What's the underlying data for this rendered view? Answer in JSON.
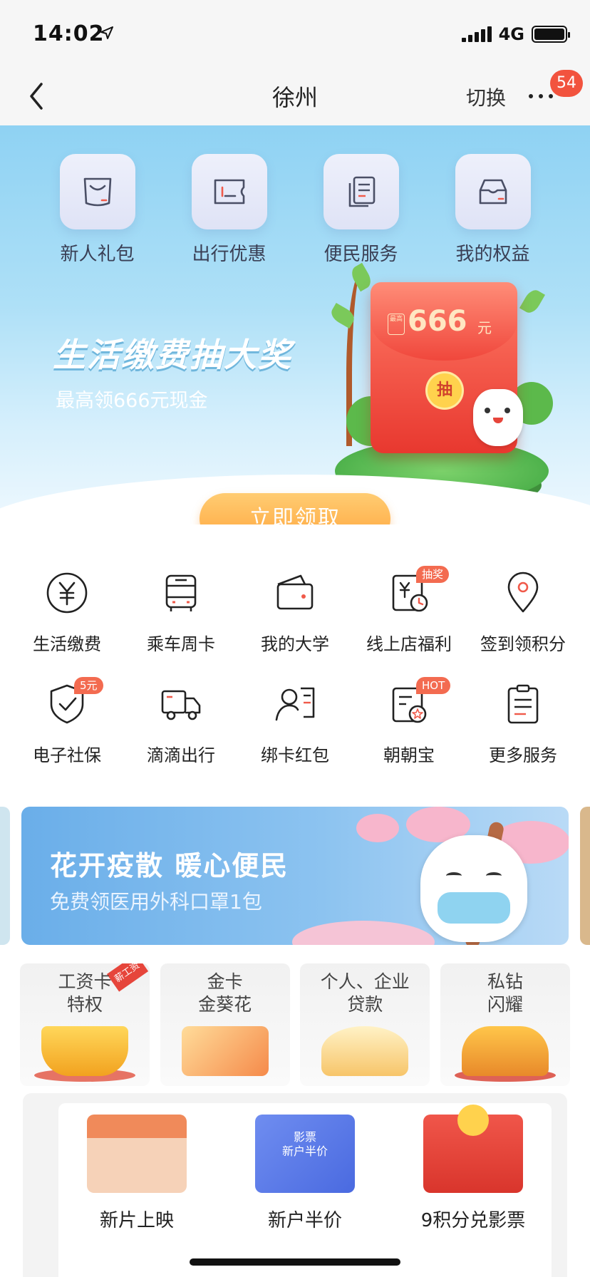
{
  "status_bar": {
    "time": "14:02",
    "network": "4G",
    "battery_level": 1.0
  },
  "nav": {
    "title": "徐州",
    "switch_label": "切换",
    "message_count": "54"
  },
  "quick_links": [
    {
      "label": "新人礼包",
      "icon": "shopping-bag-icon"
    },
    {
      "label": "出行优惠",
      "icon": "ticket-icon"
    },
    {
      "label": "便民服务",
      "icon": "documents-icon"
    },
    {
      "label": "我的权益",
      "icon": "inbox-tray-icon"
    }
  ],
  "hero": {
    "title": "生活缴费抽大奖",
    "subtitle": "最高领666元现金",
    "envelope_tag": "最高",
    "envelope_amount": "666",
    "envelope_unit": "元",
    "envelope_seal": "抽",
    "cta_label": "立即领取",
    "colors": {
      "sky": "#8fd2f3",
      "cta": "#ffa63e",
      "envelope": "#e8382f"
    }
  },
  "services": [
    [
      {
        "label": "生活缴费",
        "icon": "yen-circle-icon"
      },
      {
        "label": "乘车周卡",
        "icon": "bus-icon"
      },
      {
        "label": "我的大学",
        "icon": "wallet-icon"
      },
      {
        "label": "线上店福利",
        "icon": "yen-clock-icon",
        "badge": "抽奖"
      },
      {
        "label": "签到领积分",
        "icon": "location-pin-icon"
      }
    ],
    [
      {
        "label": "电子社保",
        "icon": "shield-check-icon",
        "badge": "5元"
      },
      {
        "label": "滴滴出行",
        "icon": "truck-icon"
      },
      {
        "label": "绑卡红包",
        "icon": "user-card-icon"
      },
      {
        "label": "朝朝宝",
        "icon": "star-document-icon",
        "badge": "HOT"
      },
      {
        "label": "更多服务",
        "icon": "clipboard-list-icon"
      }
    ]
  ],
  "banner": {
    "title": "花开疫散 暖心便民",
    "subtitle": "免费领医用外科口罩1包"
  },
  "products": [
    {
      "line1": "工资卡",
      "line2": "特权",
      "tag": "薪工资",
      "icon": "crown-icon"
    },
    {
      "line1": "金卡",
      "line2": "金葵花",
      "tag": "",
      "icon": "gold-card-icon"
    },
    {
      "line1": "个人、企业",
      "line2": "贷款",
      "tag": "",
      "icon": "coin-jar-icon"
    },
    {
      "line1": "私钻",
      "line2": "闪耀",
      "tag": "",
      "icon": "trophy-icon"
    }
  ],
  "promo": {
    "items": [
      {
        "label": "新片上映",
        "icon": "storefront-icon",
        "caption": ""
      },
      {
        "label": "新户半价",
        "icon": "movie-ticket-icon",
        "caption": "影票\n新户半价"
      },
      {
        "label": "9积分兑影票",
        "icon": "gift-box-icon",
        "caption": ""
      }
    ]
  }
}
